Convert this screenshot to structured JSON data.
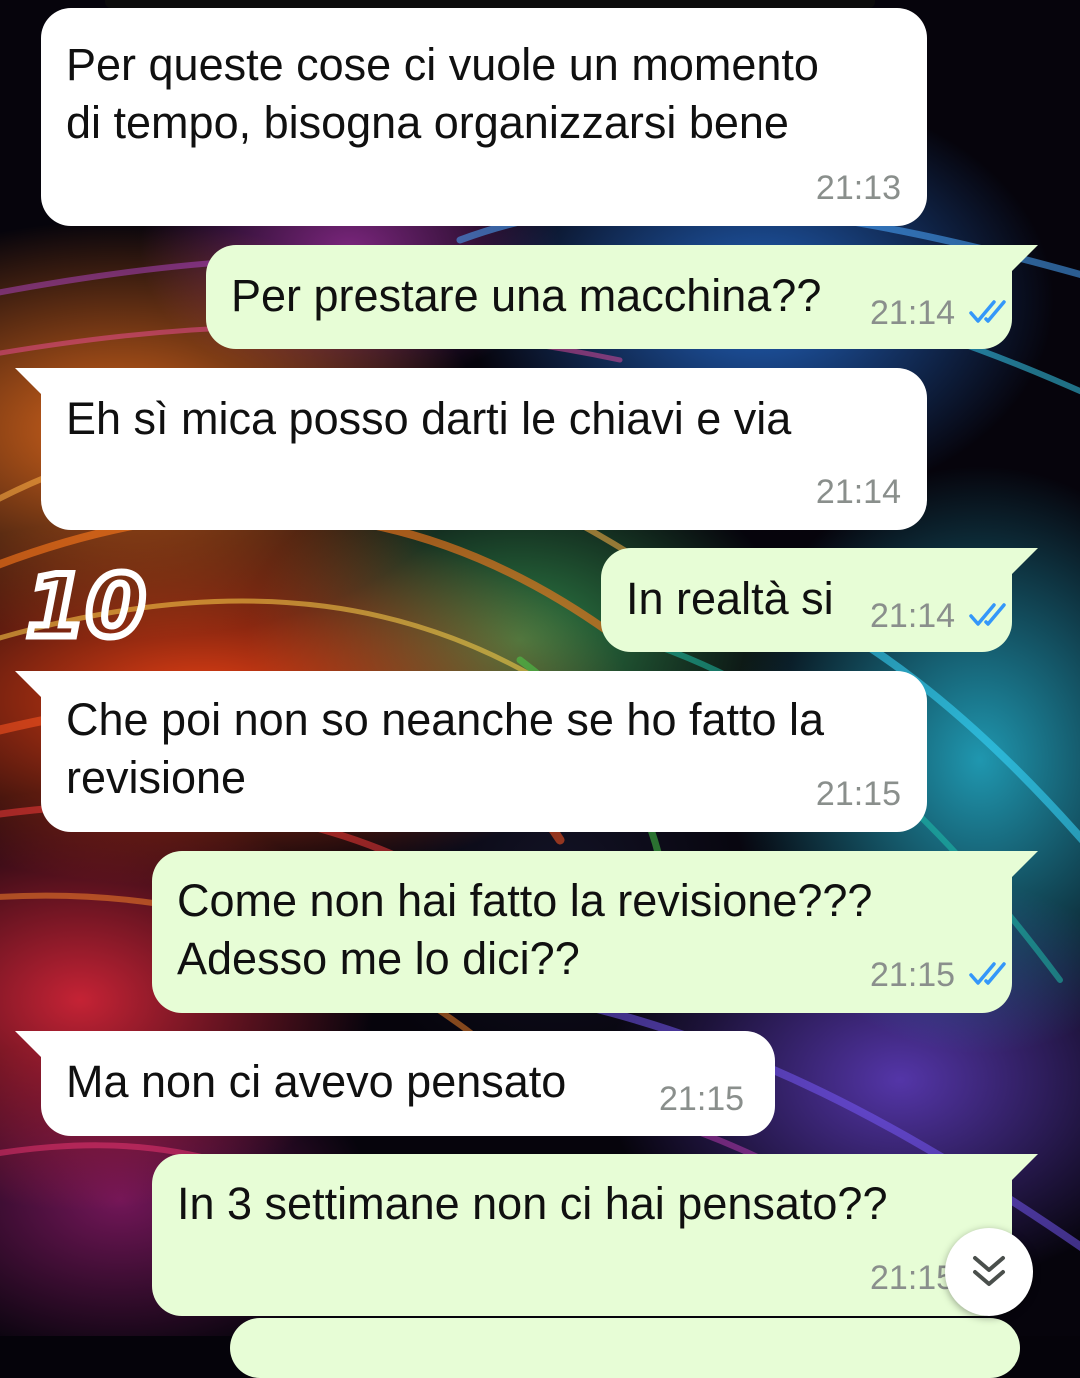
{
  "chat": {
    "messages": [
      {
        "direction": "in",
        "text": "Per queste cose ci vuole un momento\ndi tempo, bisogna organizzarsi bene",
        "time": "21:13",
        "read_receipt": ""
      },
      {
        "direction": "out",
        "text": "Per prestare una macchina??",
        "time": "21:14",
        "read_receipt": "double-check-read"
      },
      {
        "direction": "in",
        "text": "Eh sì mica posso darti le chiavi e via",
        "time": "21:14",
        "read_receipt": ""
      },
      {
        "direction": "out",
        "text": "In realtà si",
        "time": "21:14",
        "read_receipt": "double-check-read"
      },
      {
        "direction": "in",
        "text": "Che poi non so neanche se ho fatto la\nrevisione",
        "time": "21:15",
        "read_receipt": ""
      },
      {
        "direction": "out",
        "text": "Come non hai fatto la revisione???\nAdesso me lo dici??",
        "time": "21:15",
        "read_receipt": "double-check-read"
      },
      {
        "direction": "in",
        "text": "Ma non ci avevo pensato",
        "time": "21:15",
        "read_receipt": ""
      },
      {
        "direction": "out",
        "text": "In 3 settimane non ci hai pensato??",
        "time": "21:15",
        "read_receipt": "double-check-read"
      }
    ],
    "annotation": "10",
    "scroll_button_icon": "chevron-double-down-icon",
    "colors": {
      "incoming_bubble": "#ffffff",
      "outgoing_bubble": "#e7fdd6",
      "timestamp": "#8a8f8c",
      "read_ticks": "#3497f9"
    }
  }
}
